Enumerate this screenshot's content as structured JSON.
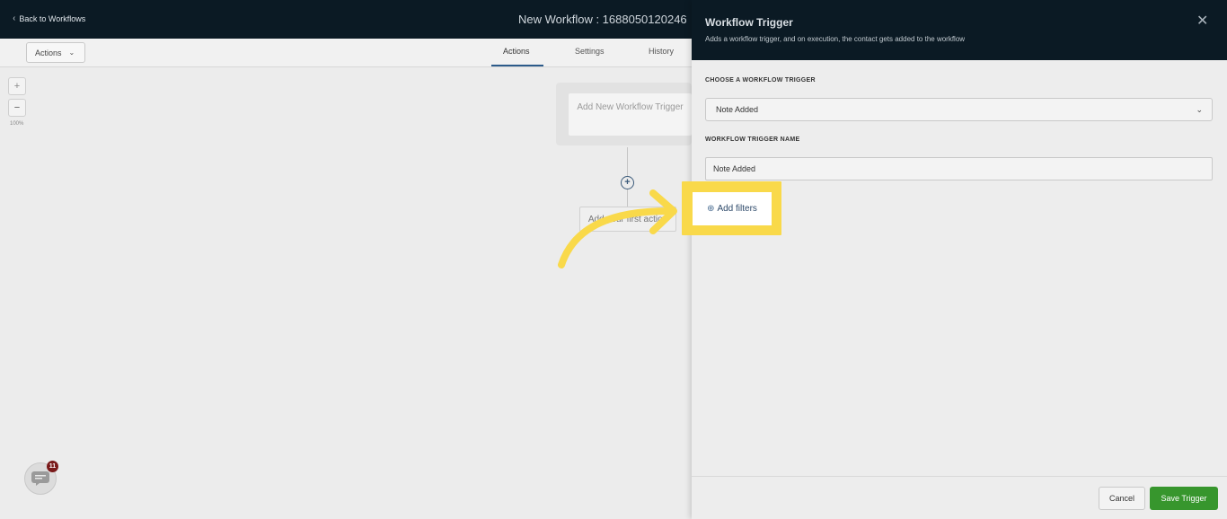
{
  "header": {
    "back_label": "Back to Workflows",
    "workflow_title": "New Workflow : 1688050120246"
  },
  "subbar": {
    "actions_label": "Actions",
    "tabs": [
      {
        "label": "Actions",
        "active": true
      },
      {
        "label": "Settings",
        "active": false
      },
      {
        "label": "History",
        "active": false
      }
    ]
  },
  "canvas": {
    "zoom_in": "+",
    "zoom_out": "−",
    "zoom_level": "100%",
    "trigger_card_text": "Add New Workflow Trigger",
    "add_step_symbol": "+",
    "first_action_text": "Add your first action",
    "chat_badge_count": "11"
  },
  "drawer": {
    "title": "Workflow Trigger",
    "subtitle": "Adds a workflow trigger, and on execution, the contact gets added to the workflow",
    "choose_label": "CHOOSE A WORKFLOW TRIGGER",
    "selected_trigger": "Note Added",
    "name_label": "WORKFLOW TRIGGER NAME",
    "name_value": "Note Added",
    "add_filters_label": "Add filters",
    "cancel_label": "Cancel",
    "save_label": "Save Trigger"
  },
  "colors": {
    "header_bg": "#0b1a24",
    "highlight": "#f9d94a",
    "save_button": "#37962d",
    "tab_accent": "#2c5b8a",
    "chat_badge": "#7a1a1a"
  },
  "icons": [
    "chevron-left-icon",
    "chevron-down-icon",
    "close-icon",
    "plus-circle-icon",
    "chat-icon",
    "callout-arrow-icon"
  ]
}
